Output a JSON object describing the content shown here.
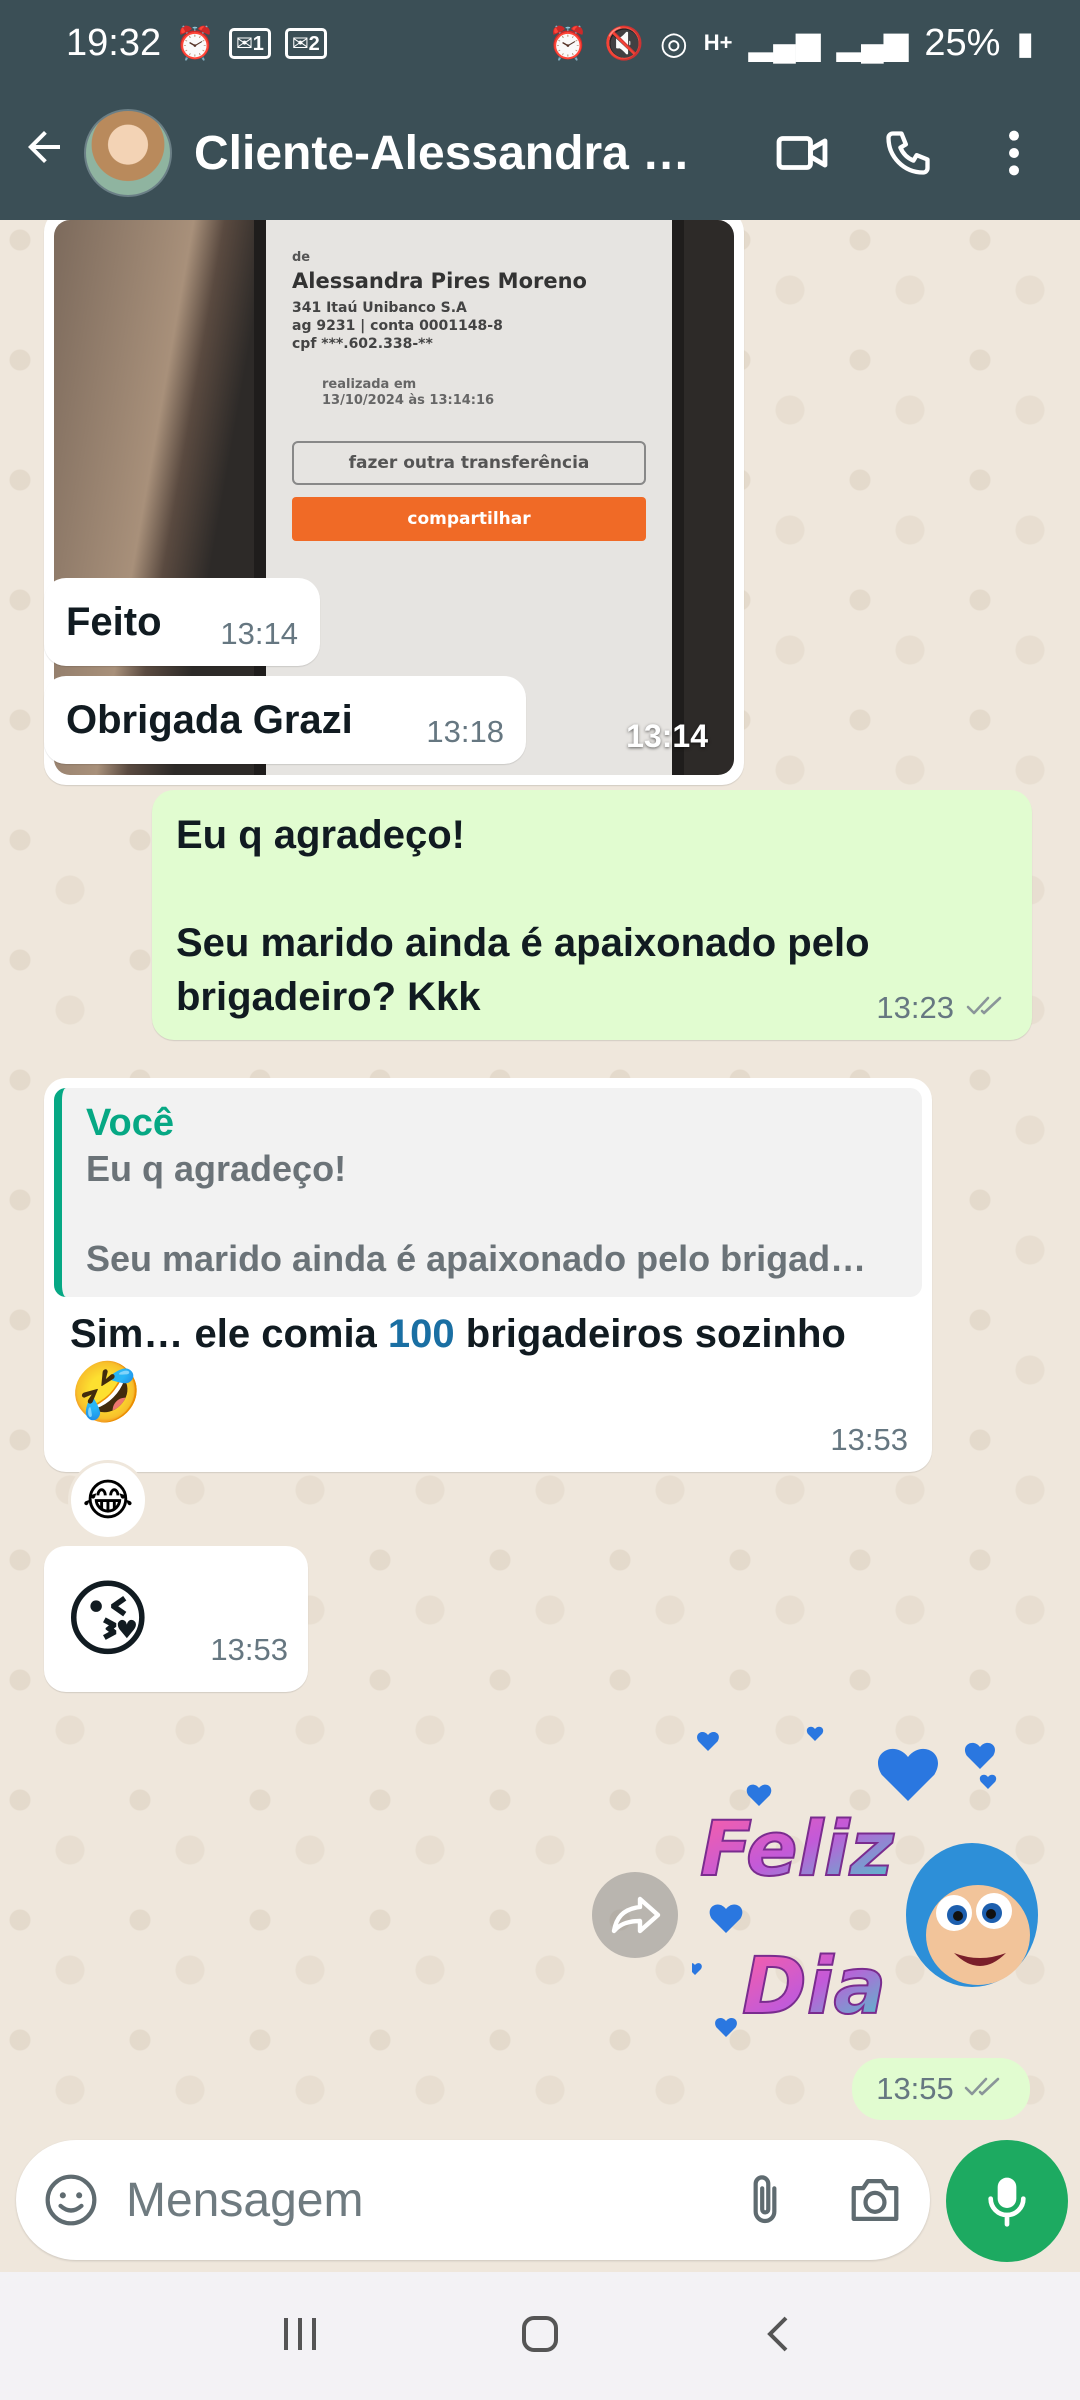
{
  "status_bar": {
    "time": "19:32",
    "battery": "25%",
    "sim1": "1",
    "sim2": "2",
    "data": "H+"
  },
  "header": {
    "title": "Cliente-Alessandra M…",
    "back_icon": "arrow-left-icon",
    "video_icon": "video-call-icon",
    "call_icon": "phone-icon",
    "menu_icon": "more-vert-icon"
  },
  "messages": {
    "image": {
      "time": "13:14",
      "receipt": {
        "from_label": "de",
        "name": "Alessandra Pires Moreno",
        "bank": "341 Itaú Unibanco S.A",
        "account": "ag 9231 | conta 0001148-8",
        "cpf": "cpf ***.602.338-**",
        "done_label": "realizada em",
        "done_at": "13/10/2024 às 13:14:16",
        "button_other": "fazer outra transferência",
        "button_share": "compartilhar"
      }
    },
    "m1": {
      "text": "Feito",
      "time": "13:14"
    },
    "m2": {
      "text": "Obrigada Grazi",
      "time": "13:18"
    },
    "m3": {
      "line1": "Eu q agradeço!",
      "line2": "Seu marido ainda é apaixonado pelo brigadeiro? Kkk",
      "time": "13:23"
    },
    "m4": {
      "quote_author": "Você",
      "quote_line1": "Eu q agradeço!",
      "quote_line2": "Seu marido ainda é apaixonado pelo brigad…",
      "text_before": "Sim… ele comia ",
      "number": "100",
      "text_after": " brigadeiros sozinho",
      "emoji": "🤣",
      "time": "13:53",
      "reaction": "😂"
    },
    "m5": {
      "emoji": "😘",
      "time": "13:53"
    },
    "sticker": {
      "text_top": "Feliz",
      "text_bottom": "Dia",
      "time": "13:55"
    }
  },
  "composer": {
    "placeholder": "Mensagem"
  },
  "colors": {
    "header": "#3b4f56",
    "chat_bg": "#efe7dc",
    "outgoing": "#e1fcd0",
    "accent": "#06a884",
    "mic": "#1daa61"
  }
}
